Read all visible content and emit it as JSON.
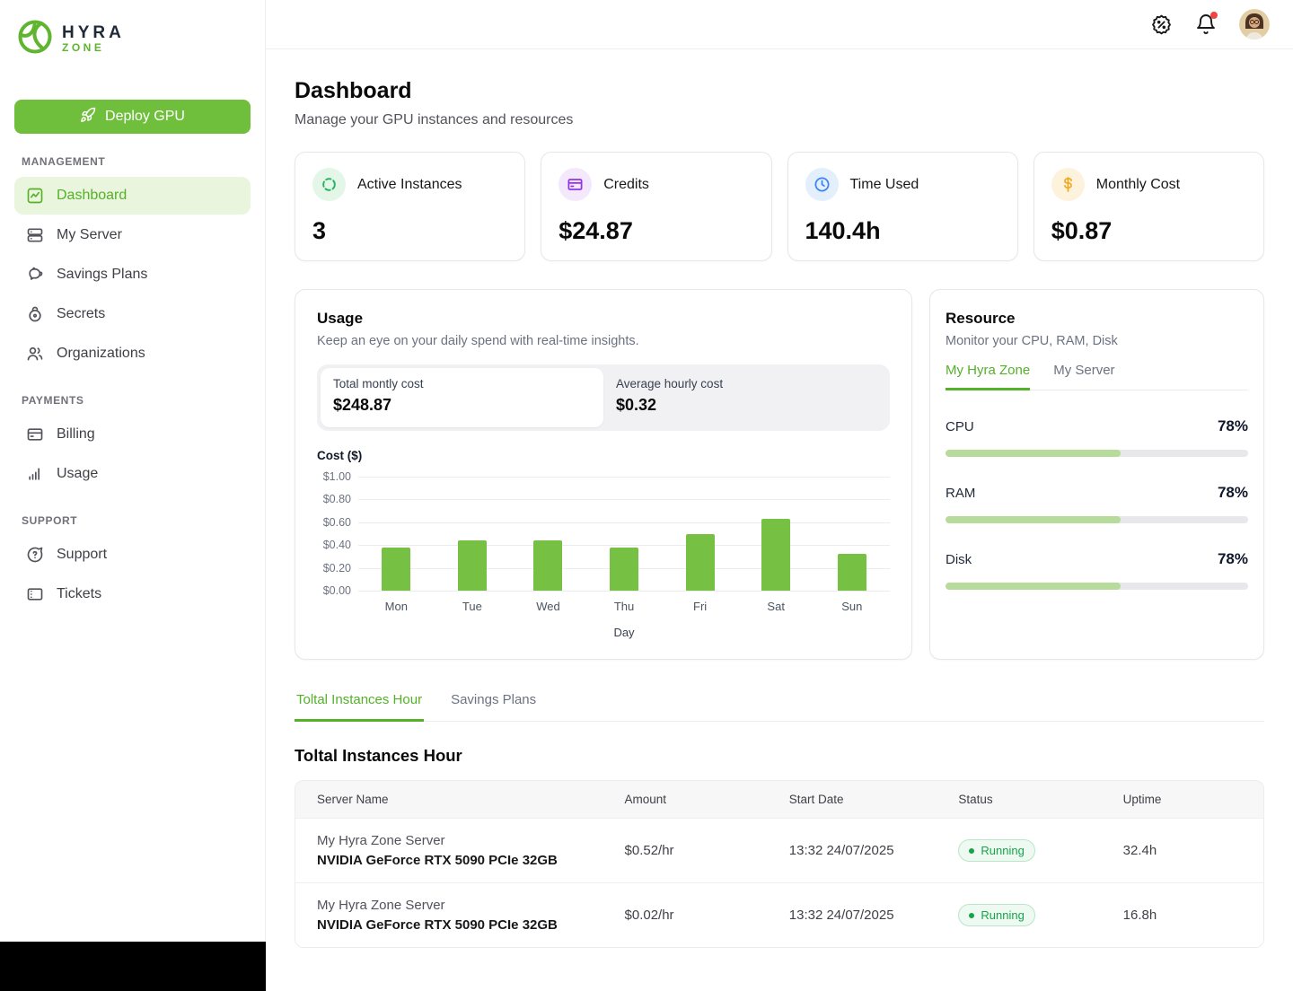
{
  "brand": {
    "name": "HYRA",
    "sub": "ZONE"
  },
  "sidebar": {
    "deploy_button": {
      "label": "Deploy GPU",
      "icon": "rocket-icon"
    },
    "sections": [
      {
        "title": "MANAGEMENT",
        "items": [
          {
            "label": "Dashboard",
            "icon": "dashboard-chart-icon",
            "active": true
          },
          {
            "label": "My Server",
            "icon": "server-icon",
            "active": false
          },
          {
            "label": "Savings Plans",
            "icon": "piggy-bank-icon",
            "active": false
          },
          {
            "label": "Secrets",
            "icon": "lock-icon",
            "active": false
          },
          {
            "label": "Organizations",
            "icon": "people-icon",
            "active": false
          }
        ]
      },
      {
        "title": "PAYMENTS",
        "items": [
          {
            "label": "Billing",
            "icon": "credit-card-icon",
            "active": false
          },
          {
            "label": "Usage",
            "icon": "bar-chart-icon",
            "active": false
          }
        ]
      },
      {
        "title": "SUPPORT",
        "items": [
          {
            "label": "Support",
            "icon": "help-chat-icon",
            "active": false
          },
          {
            "label": "Tickets",
            "icon": "ticket-icon",
            "active": false
          }
        ]
      }
    ]
  },
  "topbar": {
    "icons": [
      "discount-icon",
      "bell-icon",
      "avatar"
    ],
    "bell_has_alert": true
  },
  "page": {
    "title": "Dashboard",
    "subtitle": "Manage your GPU instances and resources"
  },
  "stats": [
    {
      "label": "Active Instances",
      "value": "3",
      "icon": "instances-ring-icon",
      "accent": "#22b35e"
    },
    {
      "label": "Credits",
      "value": "$24.87",
      "icon": "credit-card-icon",
      "accent": "#9333ea"
    },
    {
      "label": "Time Used",
      "value": "140.4h",
      "icon": "clock-icon",
      "accent": "#3b82f6"
    },
    {
      "label": "Monthly Cost",
      "value": "$0.87",
      "icon": "dollar-icon",
      "accent": "#f0a820"
    }
  ],
  "usage": {
    "title": "Usage",
    "subtitle": "Keep an eye on your daily spend with real-time insights.",
    "summary": [
      {
        "label": "Total montly cost",
        "value": "$248.87",
        "selected": true
      },
      {
        "label": "Average hourly cost",
        "value": "$0.32",
        "selected": false
      }
    ]
  },
  "chart_data": {
    "type": "bar",
    "title": "Cost ($)",
    "xlabel": "Day",
    "ylabel": "Cost ($)",
    "categories": [
      "Mon",
      "Tue",
      "Wed",
      "Thu",
      "Fri",
      "Sat",
      "Sun"
    ],
    "values": [
      0.38,
      0.44,
      0.44,
      0.38,
      0.5,
      0.63,
      0.32
    ],
    "ylim": [
      0,
      1.0
    ],
    "yticks": [
      "$1.00",
      "$0.80",
      "$0.60",
      "$0.40",
      "$0.20",
      "$0.00"
    ],
    "bar_color": "#76c043",
    "grid": true,
    "legend": false
  },
  "resource": {
    "title": "Resource",
    "subtitle": "Monitor your CPU, RAM, Disk",
    "tabs": [
      {
        "label": "My Hyra Zone",
        "active": true
      },
      {
        "label": "My Server",
        "active": false
      }
    ],
    "meters": [
      {
        "label": "CPU",
        "value": "78%"
      },
      {
        "label": "RAM",
        "value": "78%"
      },
      {
        "label": "Disk",
        "value": "78%"
      }
    ]
  },
  "section_tabs": [
    {
      "label": "Toltal Instances Hour",
      "active": true
    },
    {
      "label": "Savings Plans",
      "active": false
    }
  ],
  "instances": {
    "heading": "Toltal Instances Hour",
    "columns": [
      "Server Name",
      "Amount",
      "Start Date",
      "Status",
      "Uptime"
    ],
    "rows": [
      {
        "server": "My Hyra Zone Server",
        "gpu": "NVIDIA GeForce RTX 5090 PCIe 32GB",
        "amount": "$0.52/hr",
        "start_date": "13:32 24/07/2025",
        "status": "Running",
        "uptime": "32.4h"
      },
      {
        "server": "My Hyra Zone Server",
        "gpu": "NVIDIA GeForce RTX 5090 PCIe 32GB",
        "amount": "$0.02/hr",
        "start_date": "13:32 24/07/2025",
        "status": "Running",
        "uptime": "16.8h"
      }
    ]
  },
  "colors": {
    "primary_green": "#6fbf3c",
    "bar_green": "#76c043",
    "status_green": "#16a34a"
  }
}
